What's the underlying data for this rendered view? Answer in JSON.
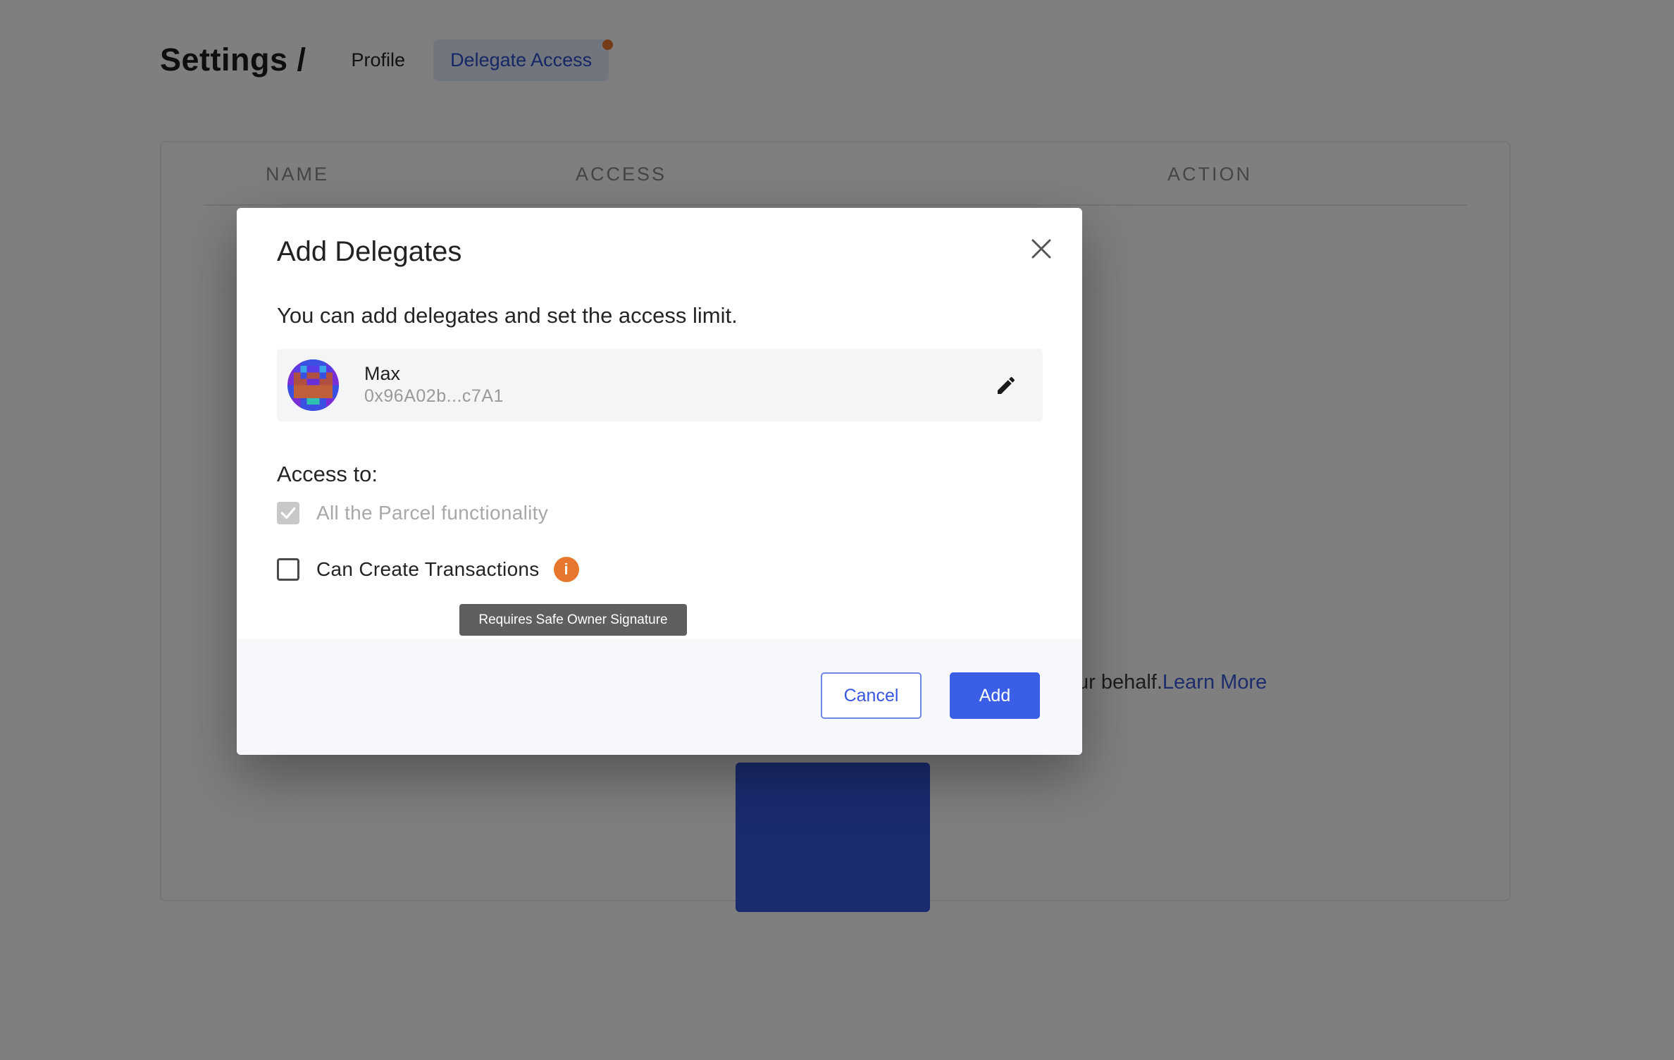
{
  "header": {
    "title": "Settings /",
    "tabs": [
      {
        "label": "Profile",
        "active": false
      },
      {
        "label": "Delegate Access",
        "active": true,
        "notification_dot": true
      }
    ]
  },
  "table": {
    "columns": [
      "NAME",
      "ACCESS",
      "ACTION"
    ]
  },
  "background": {
    "partial_text": "ur behalf.",
    "learn_more_link": "Learn More"
  },
  "modal": {
    "title": "Add Delegates",
    "close_icon": "close-icon",
    "description": "You can add delegates and set the access limit.",
    "delegate": {
      "name": "Max",
      "address": "0x96A02b...c7A1",
      "edit_icon": "pencil-icon"
    },
    "access_label": "Access to:",
    "options": [
      {
        "label": "All the Parcel functionality",
        "checked": true,
        "disabled": true
      },
      {
        "label": "Can Create Transactions",
        "checked": false,
        "disabled": false,
        "info_icon": "info-icon"
      }
    ],
    "tooltip": "Requires Safe Owner Signature",
    "buttons": {
      "cancel": "Cancel",
      "add": "Add"
    }
  },
  "colors": {
    "primary": "#3a5ee6",
    "accent_orange": "#e8772e",
    "overlay": "rgba(0,0,0,0.5)"
  }
}
